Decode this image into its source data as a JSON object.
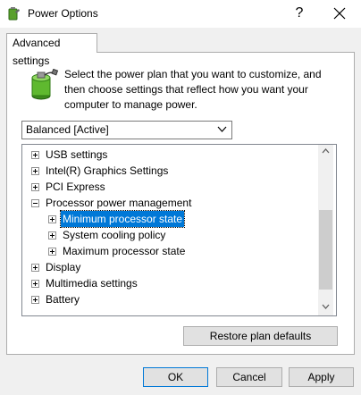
{
  "window": {
    "title": "Power Options",
    "help_label": "?"
  },
  "tabs": [
    {
      "label": "Advanced settings"
    }
  ],
  "intro_text": "Select the power plan that you want to customize, and then choose settings that reflect how you want your computer to manage power.",
  "plan_select": {
    "value": "Balanced [Active]"
  },
  "tree": [
    {
      "label": "USB settings",
      "expander": "plus",
      "level": 0
    },
    {
      "label": "Intel(R) Graphics Settings",
      "expander": "plus",
      "level": 0
    },
    {
      "label": "PCI Express",
      "expander": "plus",
      "level": 0
    },
    {
      "label": "Processor power management",
      "expander": "minus",
      "level": 0
    },
    {
      "label": "Minimum processor state",
      "expander": "plus",
      "level": 1,
      "selected": true
    },
    {
      "label": "System cooling policy",
      "expander": "plus",
      "level": 1
    },
    {
      "label": "Maximum processor state",
      "expander": "plus",
      "level": 1
    },
    {
      "label": "Display",
      "expander": "plus",
      "level": 0
    },
    {
      "label": "Multimedia settings",
      "expander": "plus",
      "level": 0
    },
    {
      "label": "Battery",
      "expander": "plus",
      "level": 0
    }
  ],
  "buttons": {
    "restore": "Restore plan defaults",
    "ok": "OK",
    "cancel": "Cancel",
    "apply": "Apply"
  },
  "colors": {
    "selection": "#0078d7",
    "button_face": "#e1e1e1"
  }
}
